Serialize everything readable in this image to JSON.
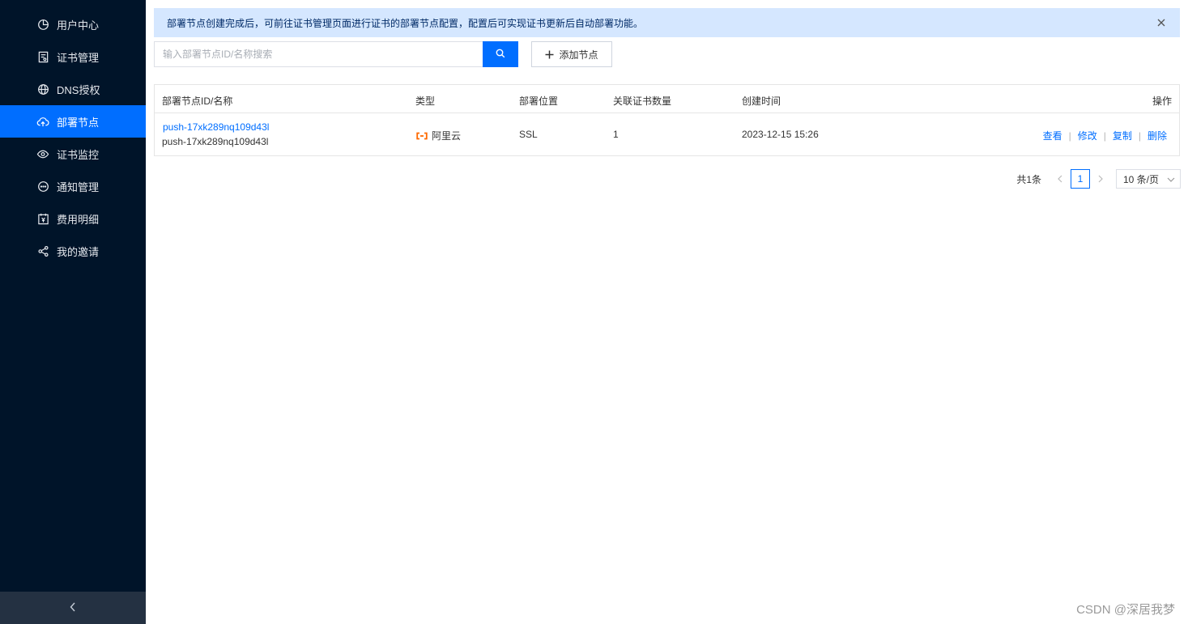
{
  "sidebar": {
    "items": [
      {
        "label": "用户中心",
        "icon": "pie-chart-icon"
      },
      {
        "label": "证书管理",
        "icon": "certificate-icon"
      },
      {
        "label": "DNS授权",
        "icon": "globe-icon"
      },
      {
        "label": "部署节点",
        "icon": "cloud-upload-icon",
        "active": true
      },
      {
        "label": "证书监控",
        "icon": "eye-icon"
      },
      {
        "label": "通知管理",
        "icon": "chat-bubble-icon"
      },
      {
        "label": "费用明细",
        "icon": "yuan-calendar-icon"
      },
      {
        "label": "我的邀请",
        "icon": "share-icon"
      }
    ],
    "collapse_icon": "chevron-left-icon"
  },
  "alert": {
    "text": "部署节点创建完成后，可前往证书管理页面进行证书的部署节点配置，配置后可实现证书更新后自动部署功能。"
  },
  "toolbar": {
    "search_placeholder": "输入部署节点ID/名称搜索",
    "search_value": "",
    "add_label": "添加节点"
  },
  "table": {
    "headers": {
      "id_name": "部署节点ID/名称",
      "type": "类型",
      "location": "部署位置",
      "cert_count": "关联证书数量",
      "created": "创建时间",
      "actions": "操作"
    },
    "rows": [
      {
        "id": "push-17xk289nq109d43l",
        "name": "push-17xk289nq109d43l",
        "type": "阿里云",
        "location": "SSL",
        "cert_count": "1",
        "created": "2023-12-15 15:26",
        "actions": {
          "view": "查看",
          "edit": "修改",
          "copy": "复制",
          "delete": "删除"
        }
      }
    ]
  },
  "pagination": {
    "total": "共1条",
    "current_page": "1",
    "page_size": "10 条/页"
  },
  "watermark": "CSDN @深居我梦",
  "colors": {
    "accent": "#006eff",
    "sidebar_bg": "#001429",
    "alert_bg": "#d5e7ff",
    "aliyun_orange": "#ff6a00"
  }
}
